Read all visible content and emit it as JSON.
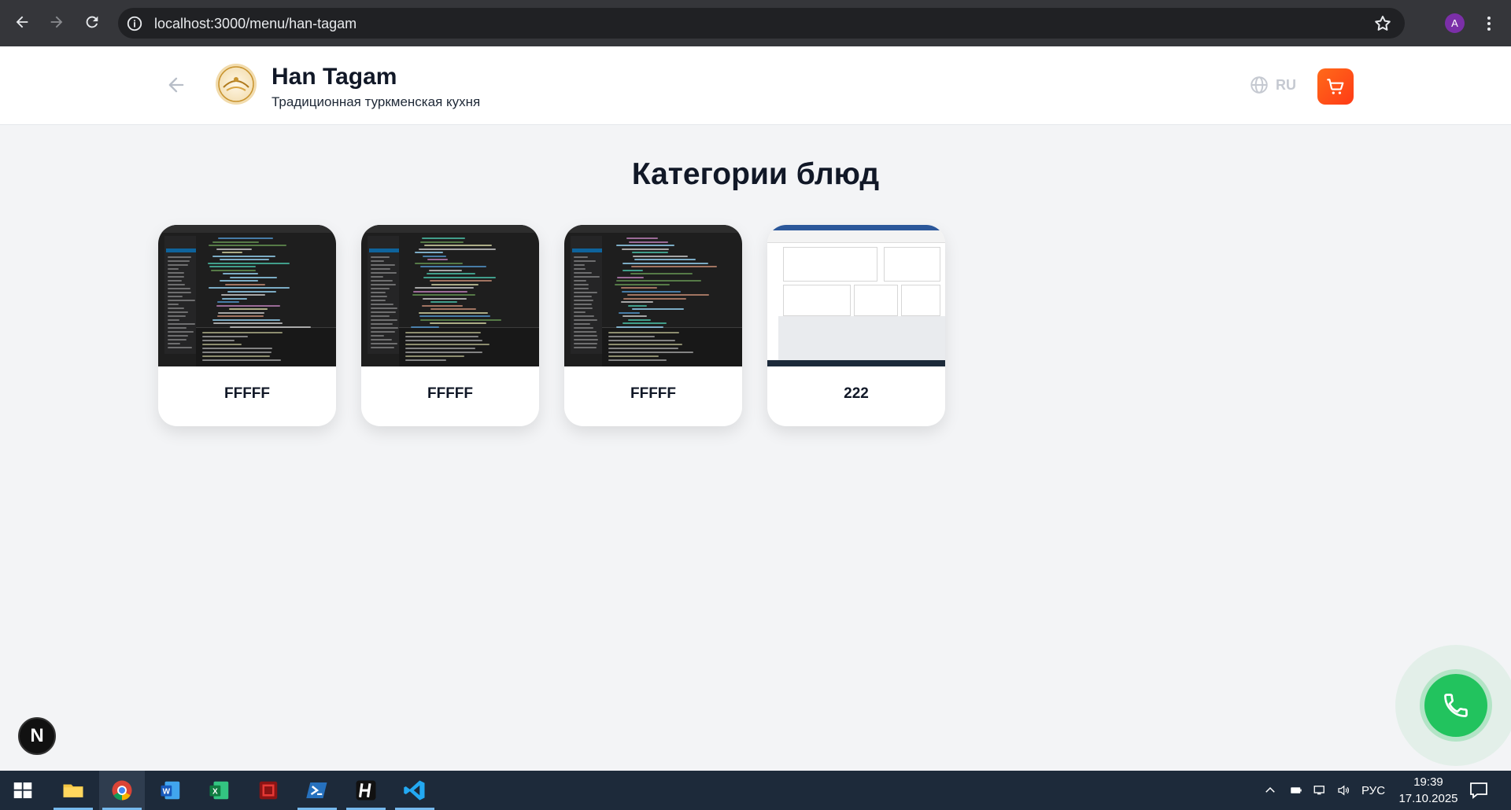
{
  "browser": {
    "url": "localhost:3000/menu/han-tagam",
    "profile_initial": "A"
  },
  "header": {
    "title": "Han Tagam",
    "subtitle": "Традиционная туркменская кухня",
    "language": "RU"
  },
  "main": {
    "page_title": "Категории блюд",
    "categories": [
      {
        "name": "FFFFF",
        "thumbnail": "code-editor-screenshot"
      },
      {
        "name": "FFFFF",
        "thumbnail": "code-editor-screenshot"
      },
      {
        "name": "FFFFF",
        "thumbnail": "code-editor-screenshot"
      },
      {
        "name": "222",
        "thumbnail": "app-window-screenshot"
      }
    ]
  },
  "floating": {
    "dev_badge": "N",
    "call_icon": "phone-icon"
  },
  "taskbar": {
    "apps": [
      "windows-start-icon",
      "file-explorer-icon",
      "chrome-icon",
      "word-icon",
      "excel-icon",
      "red-app-icon",
      "powershell-icon",
      "h-app-icon",
      "vscode-icon"
    ],
    "language": "РУС",
    "time": "19:39",
    "date": "17.10.2025"
  },
  "colors": {
    "accent": "#ff4d1a",
    "call": "#22c35e",
    "background": "#f3f4f6"
  }
}
